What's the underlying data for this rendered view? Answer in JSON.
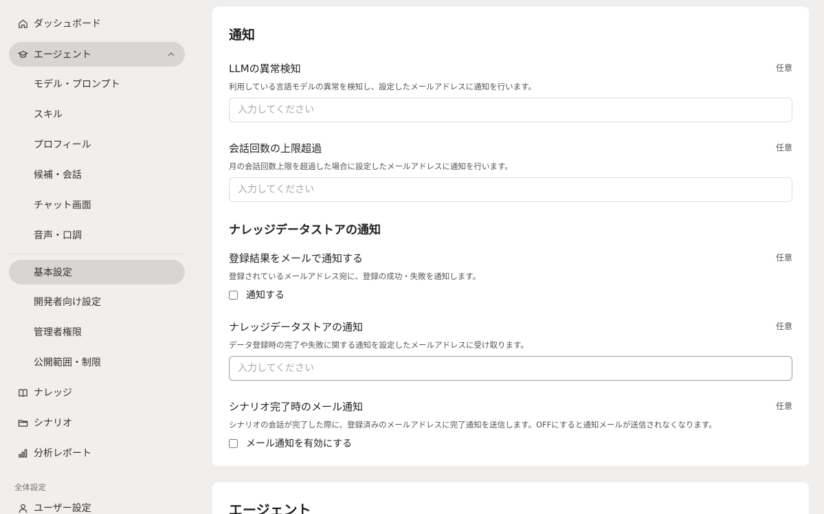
{
  "sidebar": {
    "items": [
      {
        "label": "ダッシュボード",
        "icon": "home-icon"
      },
      {
        "label": "エージェント",
        "icon": "agent-icon"
      },
      {
        "label": "モデル・プロンプト"
      },
      {
        "label": "スキル"
      },
      {
        "label": "プロフィール"
      },
      {
        "label": "候補・会話"
      },
      {
        "label": "チャット画面"
      },
      {
        "label": "音声・口調"
      },
      {
        "label": "基本設定"
      },
      {
        "label": "開発者向け設定"
      },
      {
        "label": "管理者権限"
      },
      {
        "label": "公開範囲・制限"
      },
      {
        "label": "ナレッジ",
        "icon": "book-icon"
      },
      {
        "label": "シナリオ",
        "icon": "folder-icon"
      },
      {
        "label": "分析レポート",
        "icon": "chart-icon"
      }
    ],
    "section_label": "全体設定",
    "user_settings": {
      "label": "ユーザー設定",
      "icon": "user-icon"
    }
  },
  "notifications": {
    "title": "通知",
    "llm": {
      "label": "LLMの異常検知",
      "optional": "任意",
      "desc": "利用している言語モデルの異常を検知し、設定したメールアドレスに通知を行います。",
      "placeholder": "入力してください"
    },
    "limit": {
      "label": "会話回数の上限超過",
      "optional": "任意",
      "desc": "月の会話回数上限を超過した場合に設定したメールアドレスに通知を行います。",
      "placeholder": "入力してください"
    },
    "knowledge_title": "ナレッジデータストアの通知",
    "register": {
      "label": "登録結果をメールで通知する",
      "optional": "任意",
      "desc": "登録されているメールアドレス宛に、登録の成功・失敗を通知します。",
      "checkbox_label": "通知する"
    },
    "knowledge": {
      "label": "ナレッジデータストアの通知",
      "optional": "任意",
      "desc": "データ登録時の完了や失敗に関する通知を設定したメールアドレスに受け取ります。",
      "placeholder": "入力してください"
    },
    "scenario": {
      "label": "シナリオ完了時のメール通知",
      "optional": "任意",
      "desc": "シナリオの会話が完了した際に、登録済みのメールアドレスに完了通知を送信します。OFFにすると通知メールが送信されなくなります。",
      "checkbox_label": "メール通知を有効にする"
    }
  },
  "agent_card": {
    "title": "エージェント"
  }
}
